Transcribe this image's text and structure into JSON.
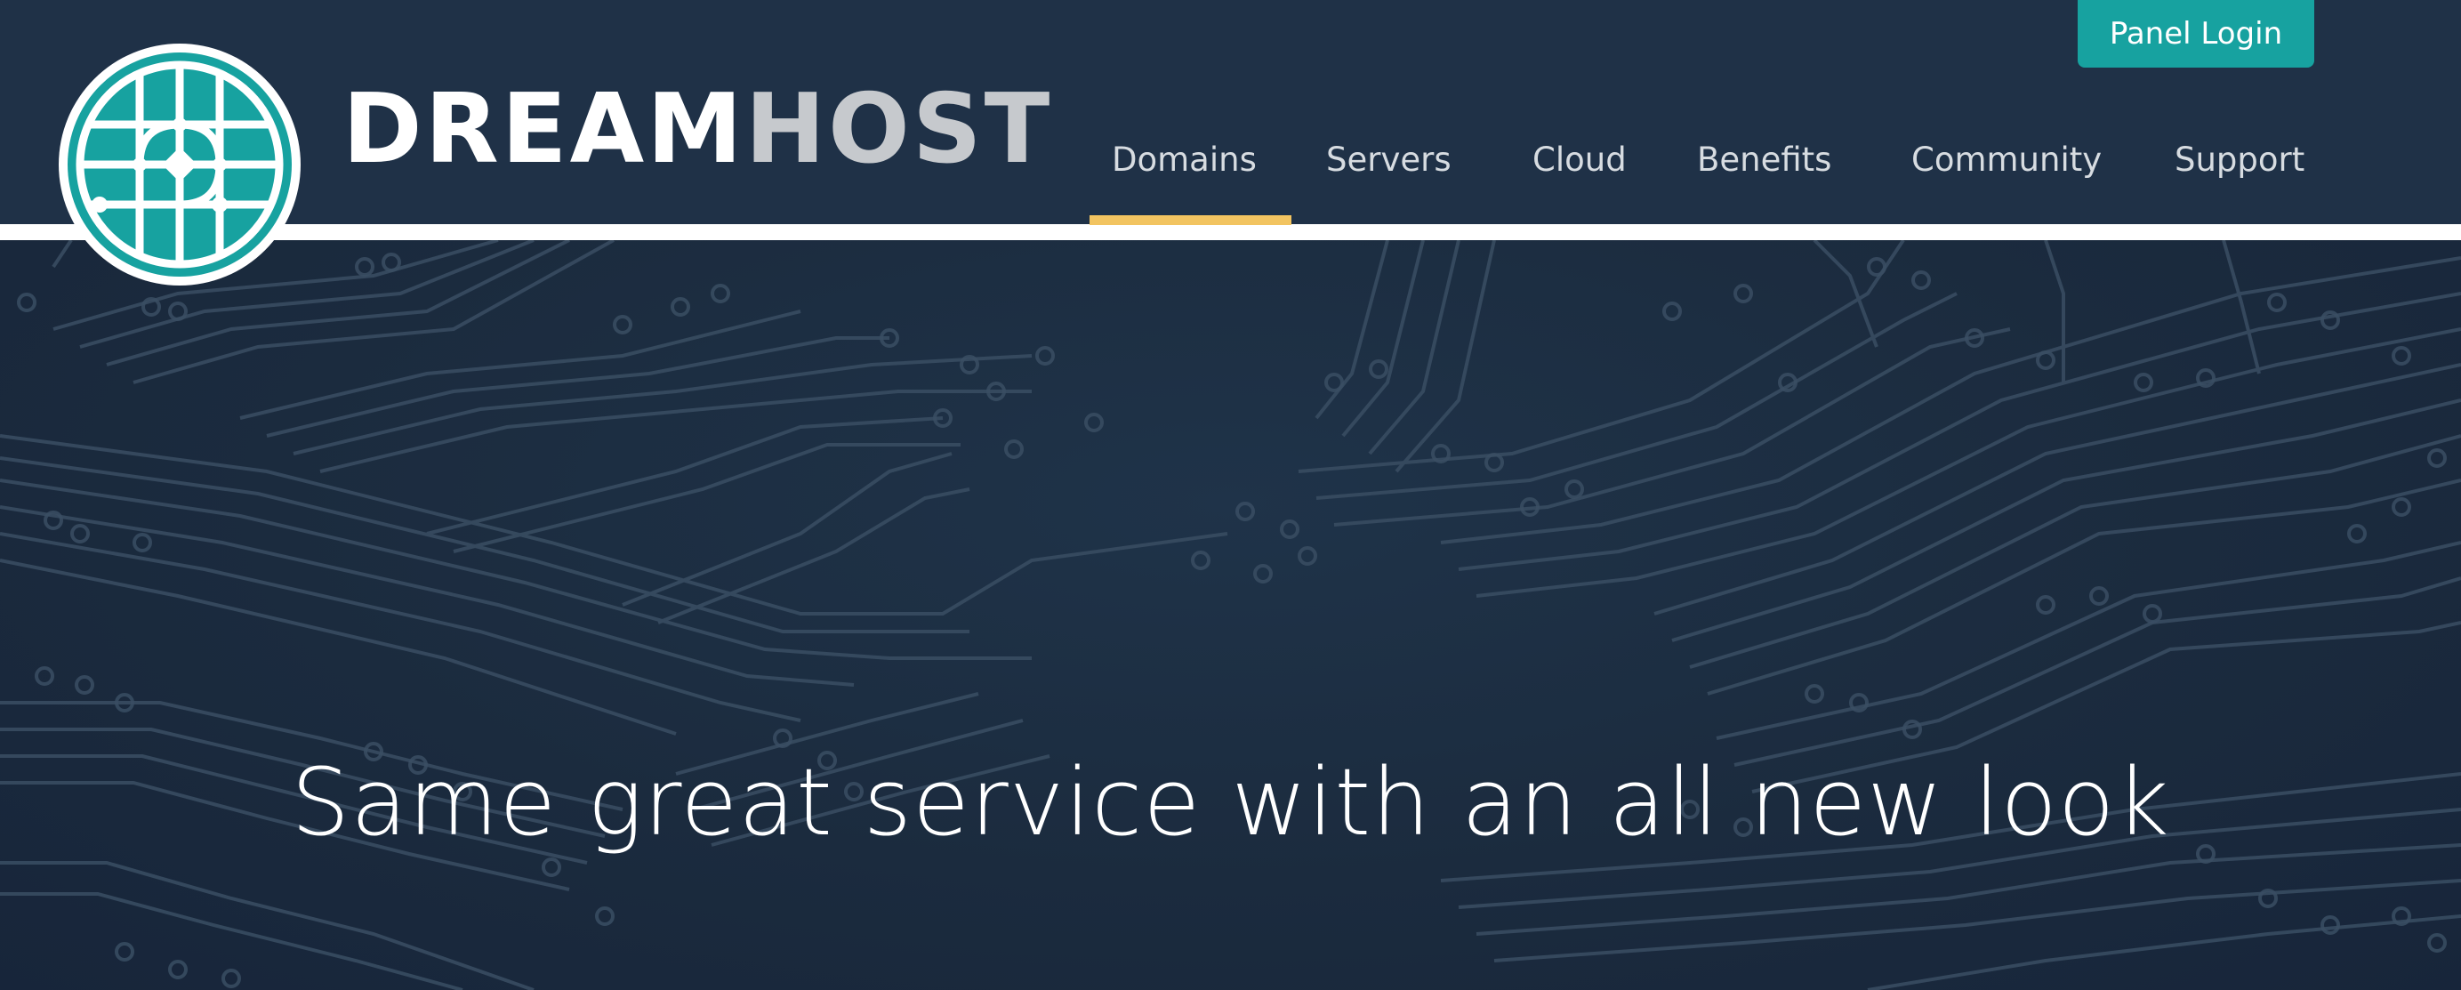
{
  "header": {
    "brand": {
      "primary": "DREAM",
      "secondary": "HOST"
    },
    "panel_login_label": "Panel Login",
    "nav": [
      {
        "label": "Domains",
        "active": true
      },
      {
        "label": "Servers",
        "active": false
      },
      {
        "label": "Cloud",
        "active": false
      },
      {
        "label": "Benefits",
        "active": false
      },
      {
        "label": "Community",
        "active": false
      },
      {
        "label": "Support",
        "active": false
      }
    ]
  },
  "hero": {
    "headline": "Same great service with an all new look",
    "background": "circuit-board-pattern"
  },
  "colors": {
    "header_bg": "#1f3147",
    "accent_teal": "#17a2a0",
    "active_underline": "#f2c461",
    "hero_bg": "#1b2b3e",
    "wordmark_secondary": "#c6c9cd"
  },
  "icons": {
    "logo": "dreamhost-logo-icon"
  }
}
